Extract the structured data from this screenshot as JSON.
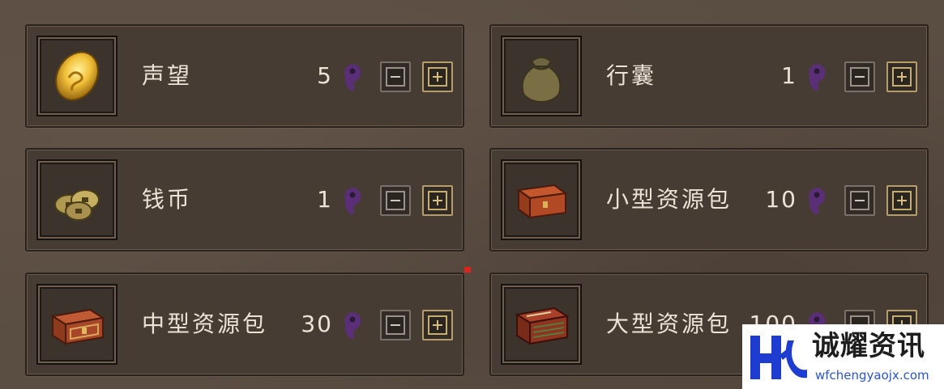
{
  "items": [
    {
      "id": "reputation",
      "name": "声望",
      "count": "5",
      "icon": "gold-coin-icon"
    },
    {
      "id": "bag",
      "name": "行囊",
      "count": "1",
      "icon": "bag-icon"
    },
    {
      "id": "coins",
      "name": "钱币",
      "count": "1",
      "icon": "coins-icon"
    },
    {
      "id": "small-pack",
      "name": "小型资源包",
      "count": "10",
      "icon": "small-chest-icon"
    },
    {
      "id": "medium-pack",
      "name": "中型资源包",
      "count": "30",
      "icon": "medium-chest-icon"
    },
    {
      "id": "large-pack",
      "name": "大型资源包",
      "count": "100",
      "icon": "large-chest-icon"
    }
  ],
  "currency_icon": "magatama-icon",
  "controls": {
    "minus_icon": "minus-icon",
    "plus_icon": "plus-icon"
  },
  "watermark": {
    "title": "诚耀资讯",
    "url": "wfchengyaojx.com"
  },
  "colors": {
    "text": "#ece3d6",
    "currency": "#5a2f78",
    "plus_border": "#b59e68",
    "panel": "#473c33"
  }
}
